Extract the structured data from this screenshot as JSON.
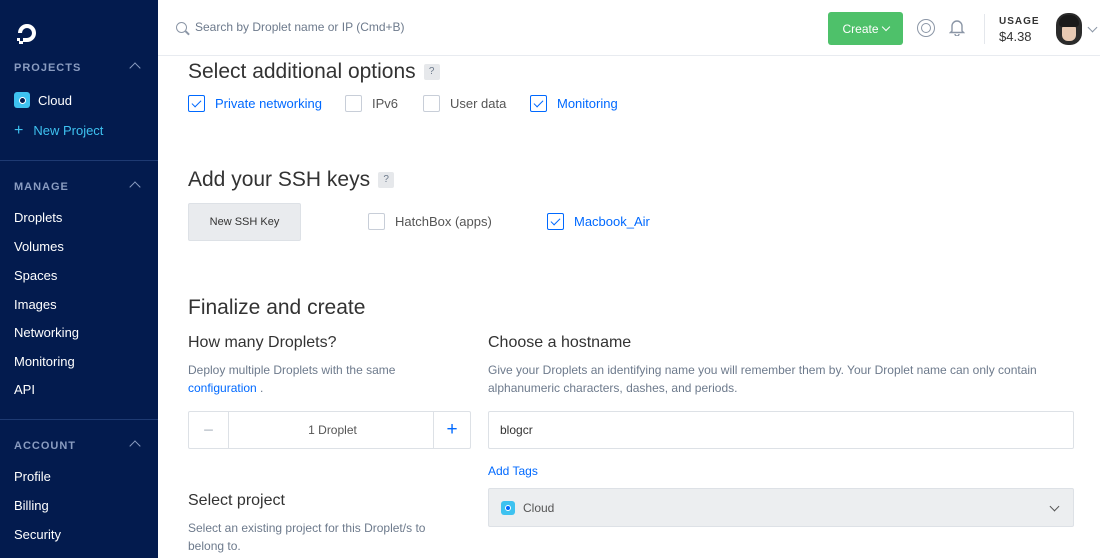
{
  "sidebar": {
    "projects_heading": "PROJECTS",
    "project_cloud": "Cloud",
    "new_project": "New Project",
    "manage_heading": "MANAGE",
    "manage_items": [
      "Droplets",
      "Volumes",
      "Spaces",
      "Images",
      "Networking",
      "Monitoring",
      "API"
    ],
    "account_heading": "ACCOUNT",
    "account_items": [
      "Profile",
      "Billing",
      "Security"
    ]
  },
  "topbar": {
    "search_placeholder": "Search by Droplet name or IP (Cmd+B)",
    "create_label": "Create",
    "usage_label": "USAGE",
    "usage_value": "$4.38",
    "create_color": "#4ec16a"
  },
  "options": {
    "title": "Select additional options",
    "help": "?",
    "items": [
      {
        "label": "Private networking",
        "checked": true
      },
      {
        "label": "IPv6",
        "checked": false
      },
      {
        "label": "User data",
        "checked": false
      },
      {
        "label": "Monitoring",
        "checked": true
      }
    ]
  },
  "ssh": {
    "title": "Add your SSH keys",
    "help": "?",
    "new_key_label": "New SSH Key",
    "keys": [
      {
        "label": "HatchBox (apps)",
        "checked": false
      },
      {
        "label": "Macbook_Air",
        "checked": true
      }
    ]
  },
  "finalize": {
    "title": "Finalize and create",
    "count_title": "How many Droplets?",
    "count_desc": "Deploy multiple Droplets with the same",
    "count_desc_link": "configuration",
    "count_desc_end": " .",
    "count_value": "1  Droplet",
    "minus": "−",
    "plus": "+",
    "hostname_title": "Choose a hostname",
    "hostname_desc": "Give your Droplets an identifying name you will remember them by. Your Droplet name can only contain alphanumeric characters, dashes, and periods.",
    "hostname_value": "blogcr",
    "add_tags": "Add Tags",
    "project_title": "Select project",
    "project_desc": "Select an existing project for this Droplet/s to belong to.",
    "project_value": "Cloud"
  },
  "colors": {
    "sidebar_bg": "#031b4e",
    "accent_blue": "#0069ff",
    "cyan": "#3ec2f0"
  }
}
